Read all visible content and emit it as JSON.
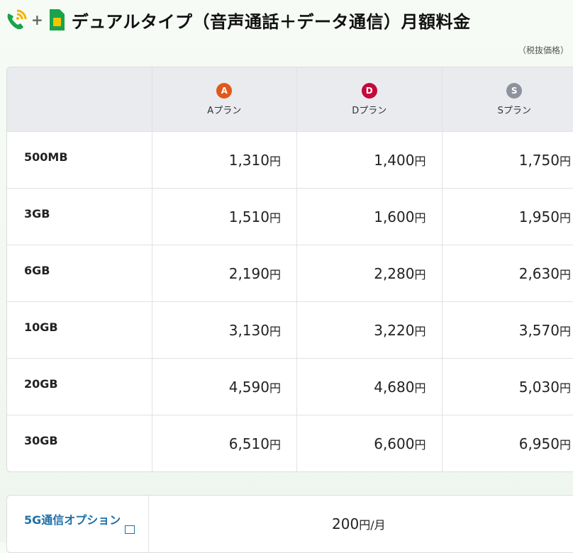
{
  "header": {
    "icons": [
      "phone-wifi-icon",
      "sim-card-icon"
    ],
    "plus": "+",
    "title": "デュアルタイプ（音声通話＋データ通信）月額料金"
  },
  "tax_note": "（税抜価格）",
  "plans": [
    {
      "badge": "A",
      "label": "Aプラン",
      "color": "#e0581c"
    },
    {
      "badge": "D",
      "label": "Dプラン",
      "color": "#c4093a"
    },
    {
      "badge": "S",
      "label": "Sプラン",
      "color": "#8d929c"
    }
  ],
  "currency": "円",
  "rows": [
    {
      "size": "500MB",
      "prices": [
        "1,310",
        "1,400",
        "1,750"
      ]
    },
    {
      "size": "3GB",
      "prices": [
        "1,510",
        "1,600",
        "1,950"
      ]
    },
    {
      "size": "6GB",
      "prices": [
        "2,190",
        "2,280",
        "2,630"
      ]
    },
    {
      "size": "10GB",
      "prices": [
        "3,130",
        "3,220",
        "3,570"
      ]
    },
    {
      "size": "20GB",
      "prices": [
        "4,590",
        "4,680",
        "5,030"
      ]
    },
    {
      "size": "30GB",
      "prices": [
        "6,510",
        "6,600",
        "6,950"
      ]
    }
  ],
  "option": {
    "label": "5G通信オプション",
    "price": "200",
    "currency": "円",
    "unit": "/月"
  }
}
